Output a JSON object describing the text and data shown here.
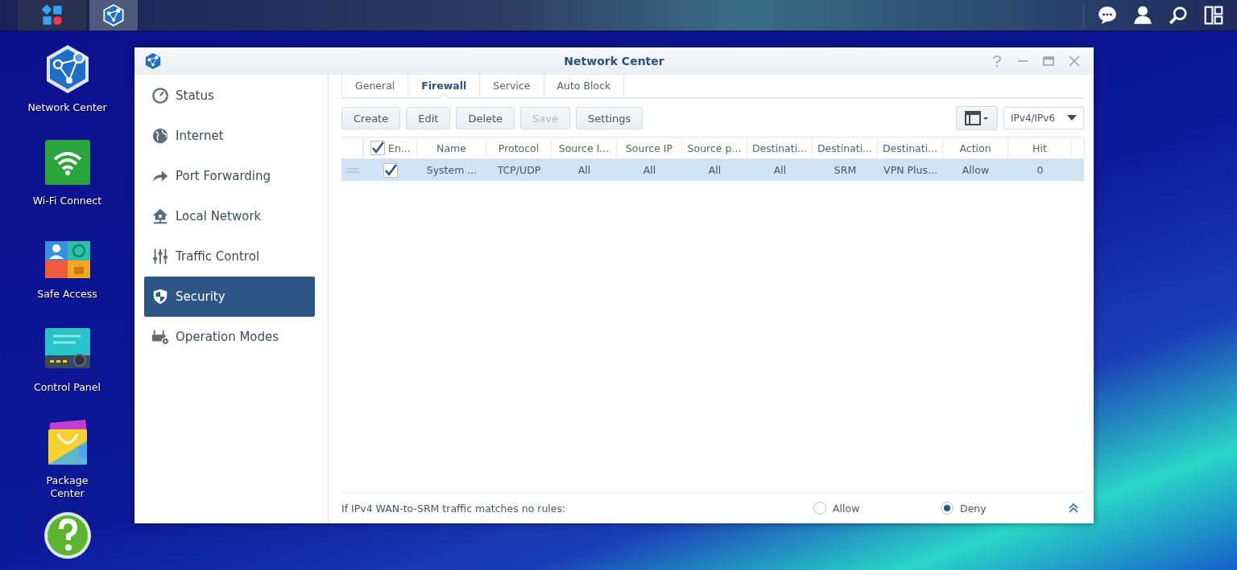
{
  "taskbar": {
    "buttons": [
      {
        "kind": "main-menu",
        "selected": false
      },
      {
        "kind": "network-center",
        "selected": true
      }
    ],
    "tray": [
      {
        "kind": "chat"
      },
      {
        "kind": "user"
      },
      {
        "kind": "search"
      },
      {
        "kind": "widgets"
      }
    ]
  },
  "desktop_icons": [
    {
      "kind": "network-center",
      "label": "Network Center"
    },
    {
      "kind": "wifi",
      "label": "Wi-Fi Connect"
    },
    {
      "kind": "safe-access",
      "label": "Safe Access"
    },
    {
      "kind": "control-panel",
      "label": "Control Panel"
    },
    {
      "kind": "package",
      "label": "Package Center"
    },
    {
      "kind": "help"
    }
  ],
  "window": {
    "title": "Network Center",
    "sidebar": {
      "items": [
        {
          "kind": "status",
          "label": "Status",
          "selected": false
        },
        {
          "kind": "internet",
          "label": "Internet",
          "selected": false
        },
        {
          "kind": "port-forwarding",
          "label": "Port Forwarding",
          "selected": false
        },
        {
          "kind": "local-network",
          "label": "Local Network",
          "selected": false
        },
        {
          "kind": "traffic-control",
          "label": "Traffic Control",
          "selected": false
        },
        {
          "kind": "security",
          "label": "Security",
          "selected": true
        },
        {
          "kind": "operation-modes",
          "label": "Operation Modes",
          "selected": false
        }
      ]
    },
    "tabs": [
      {
        "label": "General",
        "selected": false
      },
      {
        "label": "Firewall",
        "selected": true
      },
      {
        "label": "Service",
        "selected": false
      },
      {
        "label": "Auto Block",
        "selected": false
      }
    ],
    "toolbar": {
      "buttons": [
        {
          "label": "Create",
          "disabled": false
        },
        {
          "label": "Edit",
          "disabled": false
        },
        {
          "label": "Delete",
          "disabled": false
        },
        {
          "label": "Save",
          "disabled": true
        },
        {
          "label": "Settings",
          "disabled": false
        }
      ],
      "protocol_dropdown": {
        "value": "IPv4/IPv6"
      }
    },
    "table": {
      "select_all": {
        "label": "En...",
        "checked": true
      },
      "columns": [
        "Name",
        "Protocol",
        "Source I...",
        "Source IP",
        "Source p...",
        "Destinati...",
        "Destinati...",
        "Destinati...",
        "Action",
        "Hit"
      ],
      "rows": [
        {
          "selected": true,
          "enabled": true,
          "cells": [
            "System ...",
            "TCP/UDP",
            "All",
            "All",
            "All",
            "All",
            "SRM",
            "VPN Plus...",
            "Allow",
            "0"
          ]
        }
      ]
    },
    "footer": {
      "text": "If IPv4 WAN-to-SRM traffic matches no rules:",
      "options": [
        {
          "label": "Allow",
          "selected": false
        },
        {
          "label": "Deny",
          "selected": true
        }
      ]
    }
  }
}
